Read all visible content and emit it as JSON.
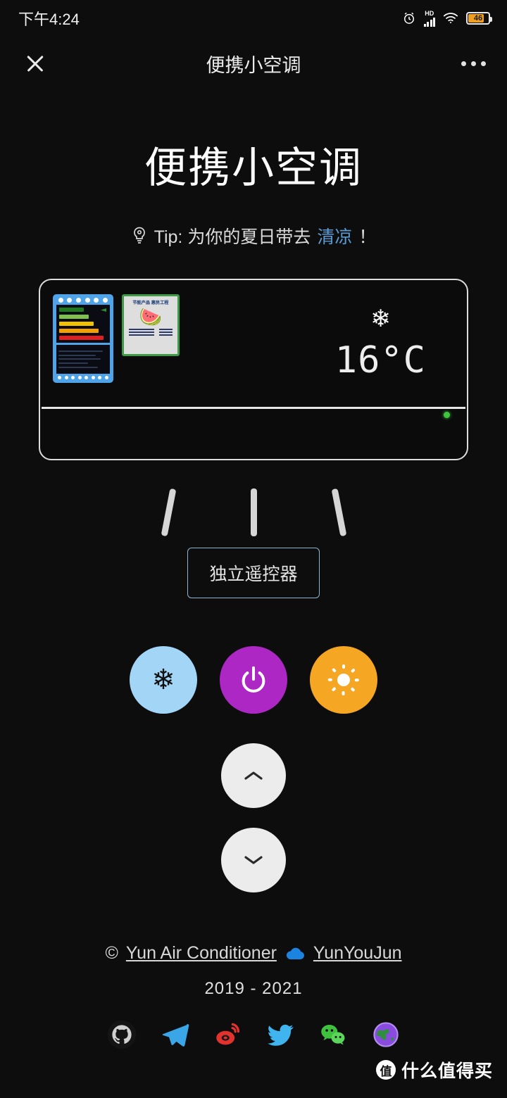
{
  "statusbar": {
    "time": "下午4:24",
    "alarm_icon": "alarm-clock-icon",
    "hd_label": "HD",
    "signal_icon": "signal-bars-icon",
    "wifi_icon": "wifi-icon",
    "battery_percent": "46"
  },
  "navbar": {
    "close_icon": "close-icon",
    "title": "便携小空调",
    "more_icon": "more-options-icon"
  },
  "hero": {
    "title": "便携小空调",
    "tip_icon": "lightbulb-icon",
    "tip_prefix": "Tip: 为你的夏日带去",
    "tip_accent": "清凉",
    "tip_suffix": "！"
  },
  "ac_unit": {
    "energy_sticker": {
      "name": "energy-efficiency-label",
      "bar_colors": [
        "#1f7a1f",
        "#7fc14a",
        "#f2c200",
        "#f0a000",
        "#e02020"
      ]
    },
    "green_sticker": {
      "name": "energy-saving-product-label",
      "heading": "节能产品 惠民工程",
      "image_icon": "watermelon-icon"
    },
    "display": {
      "mode_icon": "snowflake-icon",
      "mode_glyph": "❄",
      "temperature": "16°C"
    },
    "led_indicator": "power-led-green"
  },
  "airflow": {
    "left": "airflow-line-left",
    "center": "airflow-line-center",
    "right": "airflow-line-right"
  },
  "remote": {
    "label": "独立遥控器"
  },
  "controls": {
    "cool": {
      "name": "cool-mode-button",
      "glyph": "❄",
      "color": "#a3d5f7"
    },
    "power": {
      "name": "power-button",
      "color": "#ad27c4"
    },
    "heat": {
      "name": "heat-mode-button",
      "color": "#f5a623"
    },
    "temp_up": {
      "name": "temperature-up-button"
    },
    "temp_down": {
      "name": "temperature-down-button"
    }
  },
  "footer": {
    "copyright_symbol": "©",
    "project_link": "Yun Air Conditioner",
    "cloud_icon": "cloud-icon",
    "author_link": "YunYouJun",
    "years": "2019 - 2021",
    "socials": [
      {
        "name": "github-icon"
      },
      {
        "name": "telegram-icon"
      },
      {
        "name": "weibo-icon"
      },
      {
        "name": "twitter-icon"
      },
      {
        "name": "wechat-icon"
      },
      {
        "name": "globe-icon"
      }
    ]
  },
  "watermark": {
    "badge": "值",
    "text": "什么值得买"
  }
}
